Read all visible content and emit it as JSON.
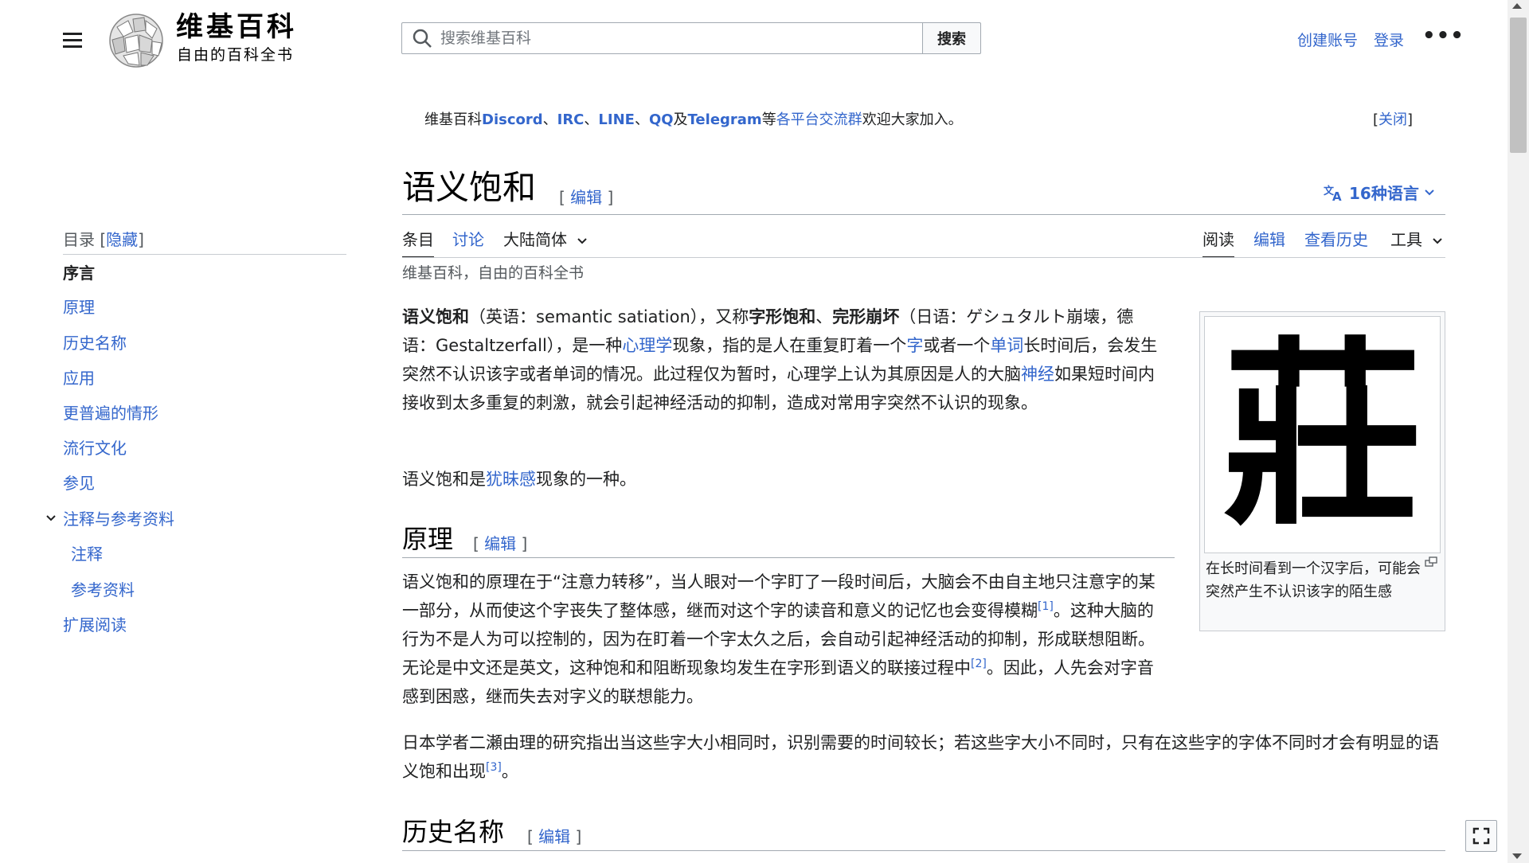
{
  "header": {
    "wordmark": "维基百科",
    "tagline": "自由的百科全书",
    "search_placeholder": "搜索维基百科",
    "search_button": "搜索",
    "create_account": "创建账号",
    "login": "登录",
    "more": "•••"
  },
  "notice": {
    "prefix": "维基百科",
    "discord": "Discord",
    "sep1": "、",
    "irc": "IRC",
    "sep2": "、",
    "line": "LINE",
    "sep3": "、",
    "qq": "QQ",
    "and": "及",
    "telegram": "Telegram",
    "etc": "等",
    "groups_link": "各平台交流群",
    "suffix": "欢迎大家加入。",
    "close_open": "[",
    "close": "关闭",
    "close_end": "]"
  },
  "title": {
    "text": "语义饱和",
    "edit_open": "[ ",
    "edit": "编辑",
    "edit_close": " ]",
    "languages": "16种语言"
  },
  "tabs": {
    "article": "条目",
    "talk": "讨论",
    "variant": "大陆简体",
    "read": "阅读",
    "edit": "编辑",
    "history": "查看历史",
    "tools": "工具"
  },
  "site_sub": "维基百科，自由的百科全书",
  "toc": {
    "title": "目录",
    "hide_open": "[",
    "hide": "隐藏",
    "hide_close": "]",
    "items": [
      "序言",
      "原理",
      "历史名称",
      "应用",
      "更普遍的情形",
      "流行文化",
      "参见",
      "注释与参考资料",
      "注释",
      "参考资料",
      "扩展阅读"
    ]
  },
  "article": {
    "p1": {
      "t1": "语义饱和",
      "t2": "（英语：semantic satiation），又称",
      "t3": "字形饱和",
      "t4": "、",
      "t5": "完形崩坏",
      "t6": "（日语：ゲシュタルト崩壊，德语：Gestaltzerfall），是一种",
      "l1": "心理学",
      "t7": "现象，指的是人在重复盯着一个",
      "l2": "字",
      "t8": "或者一个",
      "l3": "单词",
      "t9": "长时间后，会发生突然不认识该字或者单词的情况。此过程仅为暂时，心理学上认为其原因是人的大脑",
      "l4": "神经",
      "t10": "如果短时间内接收到太多重复的刺激，就会引起神经活动的抑制，造成对常用字突然不认识的现象。"
    },
    "p2": {
      "t1": "语义饱和是",
      "l1": "犹昧感",
      "t2": "现象的一种。"
    },
    "h_principle": "原理",
    "edit_open": "[ ",
    "edit": "编辑",
    "edit_close": " ]",
    "p3": {
      "t1": "语义饱和的原理在于“注意力转移”，当人眼对一个字盯了一段时间后，大脑会不由自主地只注意字的某一部分，从而使这个字丧失了整体感，继而对这个字的读音和意义的记忆也会变得模糊",
      "r1": "[1]",
      "t2": "。这种大脑的行为不是人为可以控制的，因为在盯着一个字太久之后，会自动引起神经活动的抑制，形成联想阻断。无论是中文还是英文，这种饱和和阻断现象均发生在字形到语义的联接过程中",
      "r2": "[2]",
      "t3": "。因此，人先会对字音感到困惑，继而失去对字义的联想能力。"
    },
    "p4": {
      "t1": "日本学者二瀬由理的研究指出当这些字大小相同时，识别需要的时间较长；若这些字大小不同时，只有在这些字的字体不同时才会有明显的语义饱和出现",
      "r1": "[3]",
      "t2": "。"
    },
    "h_history": "历史名称"
  },
  "thumbnail": {
    "character": "莊",
    "caption": "在长时间看到一个汉字后，可能会突然产生不认识该字的陌生感"
  },
  "colors": {
    "link": "#3366cc",
    "text": "#202122",
    "muted": "#54595d",
    "border": "#a2a9b1"
  }
}
